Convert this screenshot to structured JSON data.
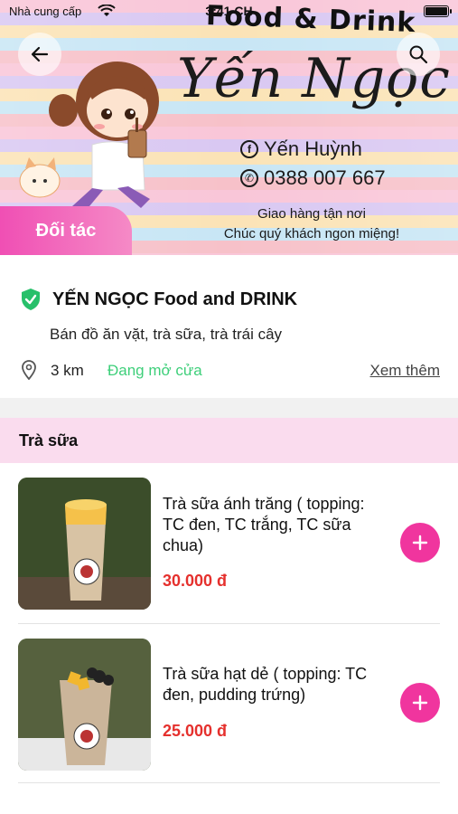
{
  "status_bar": {
    "carrier": "Nhà cung cấp",
    "time": "3:41 CH"
  },
  "banner": {
    "brand_tagline": "Food & Drink",
    "brand_name": "Yến Ngọc",
    "facebook_name": "Yến Huỳnh",
    "phone": "0388 007 667",
    "delivery_line_1": "Giao hàng tận nơi",
    "delivery_line_2": "Chúc quý khách ngon miệng!",
    "partner_label": "Đối tác",
    "back_icon": "arrow-left-icon",
    "search_icon": "search-icon"
  },
  "shop": {
    "title": "YẾN NGỌC Food and DRINK",
    "description": "Bán đồ ăn vặt, trà sữa, trà trái cây",
    "distance": "3 km",
    "status": "Đang mở cửa",
    "see_more": "Xem thêm",
    "status_color": "#3ecf7a"
  },
  "category": {
    "title": "Trà sữa"
  },
  "products": [
    {
      "name": "Trà sữa ánh trăng ( topping: TC đen, TC trắng, TC sữa chua)",
      "price": "30.000 đ"
    },
    {
      "name": "Trà sữa hạt dẻ ( topping: TC đen, pudding trứng)",
      "price": "25.000 đ"
    }
  ],
  "colors": {
    "accent": "#f0359e",
    "price": "#e5302d",
    "category_bg": "#fadcee"
  }
}
